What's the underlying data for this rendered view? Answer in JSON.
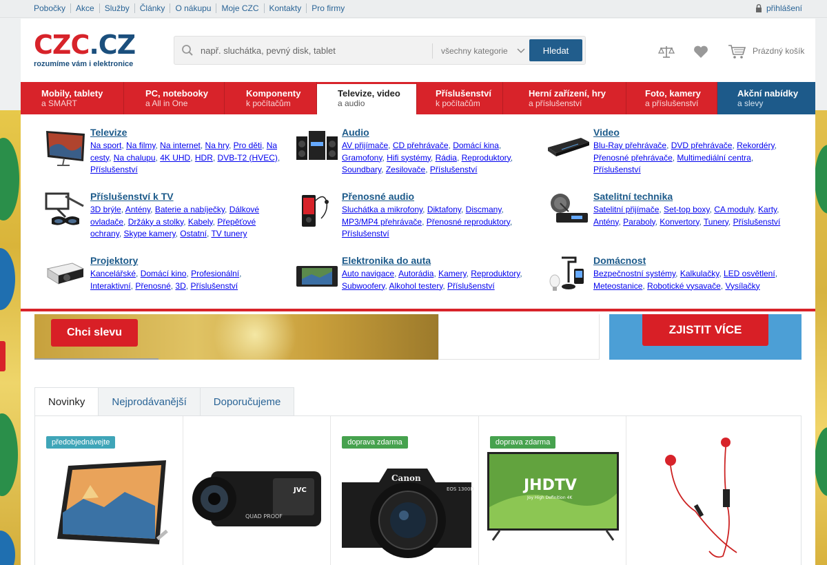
{
  "topbar": {
    "links": [
      "Pobočky",
      "Akce",
      "Služby",
      "Články",
      "O nákupu",
      "Moje CZC",
      "Kontakty",
      "Pro firmy"
    ],
    "login": "přihlášení"
  },
  "header": {
    "logo_main": "CZC",
    "logo_dot": ".CZ",
    "logo_tagline": "rozumíme vám i elektronice",
    "search_placeholder": "např. sluchátka, pevný disk, tablet",
    "category_select": "všechny kategorie",
    "search_button": "Hledat",
    "cart_label": "Prázdný košík"
  },
  "nav": [
    {
      "l1": "Mobily, tablety",
      "l2": "a SMART"
    },
    {
      "l1": "PC, notebooky",
      "l2": "a All in One"
    },
    {
      "l1": "Komponenty",
      "l2": "k počítačům"
    },
    {
      "l1": "Televize, video",
      "l2": "a audio"
    },
    {
      "l1": "Příslušenství",
      "l2": "k počítačům"
    },
    {
      "l1": "Herní zařízení, hry",
      "l2": "a příslušenství"
    },
    {
      "l1": "Foto, kamery",
      "l2": "a příslušenství"
    },
    {
      "l1": "Akční nabídky",
      "l2": "a slevy"
    }
  ],
  "mega": {
    "tv": {
      "title": "Televize",
      "links": [
        "Na sport",
        "Na filmy",
        "Na internet",
        "Na hry",
        "Pro děti",
        "Na cesty",
        "Na chalupu",
        "4K UHD",
        "HDR",
        "DVB-T2 (HVEC)",
        "Příslušenství"
      ]
    },
    "audio": {
      "title": "Audio",
      "links": [
        "AV přijímače",
        "CD přehrávače",
        "Domácí kina",
        "Gramofony",
        "Hifi systémy",
        "Rádia",
        "Reproduktory",
        "Soundbary",
        "Zesilovače",
        "Příslušenství"
      ]
    },
    "video": {
      "title": "Video",
      "links": [
        "Blu-Ray přehrávače",
        "DVD přehrávače",
        "Rekordéry",
        "Přenosné přehrávače",
        "Multimediální centra",
        "Příslušenství"
      ]
    },
    "tvacc": {
      "title": "Příslušenství k TV",
      "links": [
        "3D brýle",
        "Antény",
        "Baterie a nabíječky",
        "Dálkové ovladače",
        "Držáky a stolky",
        "Kabely",
        "Přepěťové ochrany",
        "Skype kamery",
        "Ostatní",
        "TV tunery"
      ]
    },
    "portable": {
      "title": "Přenosné audio",
      "links": [
        "Sluchátka a mikrofony",
        "Diktafony",
        "Discmany",
        "MP3/MP4 přehrávače",
        "Přenosné reproduktory",
        "Příslušenství"
      ]
    },
    "sat": {
      "title": "Satelitní technika",
      "links": [
        "Satelitní přijímače",
        "Set-top boxy",
        "CA moduly",
        "Karty",
        "Antény",
        "Paraboly",
        "Konvertory",
        "Tunery",
        "Příslušenství"
      ]
    },
    "proj": {
      "title": "Projektory",
      "links": [
        "Kancelářské",
        "Domácí kino",
        "Profesionální",
        "Interaktivní",
        "Přenosné",
        "3D",
        "Příslušenství"
      ]
    },
    "car": {
      "title": "Elektronika do auta",
      "links": [
        "Auto navigace",
        "Autorádia",
        "Kamery",
        "Reproduktory",
        "Subwoofery",
        "Alkohol testery",
        "Příslušenství"
      ]
    },
    "home": {
      "title": "Domácnost",
      "links": [
        "Bezpečnostní systémy",
        "Kalkulačky",
        "LED osvětlení",
        "Meteostanice",
        "Robotické vysavače",
        "Vysílačky"
      ]
    }
  },
  "banners": {
    "left_button": "Chci slevu",
    "right_button": "ZJISTIT VÍCE"
  },
  "tabs": [
    "Novinky",
    "Nejprodávanější",
    "Doporučujeme"
  ],
  "products": [
    {
      "badge": "předobjednávejte"
    },
    {
      "badge": ""
    },
    {
      "badge": "doprava zdarma"
    },
    {
      "badge": "doprava zdarma"
    },
    {
      "badge": ""
    }
  ],
  "product_texts": {
    "camera_brand": "Canon",
    "camera_model": "EOS 1300D",
    "tv_brand": "JHDTV",
    "tv_sub": "Joy High Definition 4K",
    "camcorder_brand": "JVC",
    "camcorder_label": "QUAD PROOF"
  },
  "colors": {
    "brand_red": "#d8232a",
    "brand_blue": "#1c5a8a",
    "badge_teal": "#3fa5b8",
    "badge_green": "#46a24e"
  }
}
